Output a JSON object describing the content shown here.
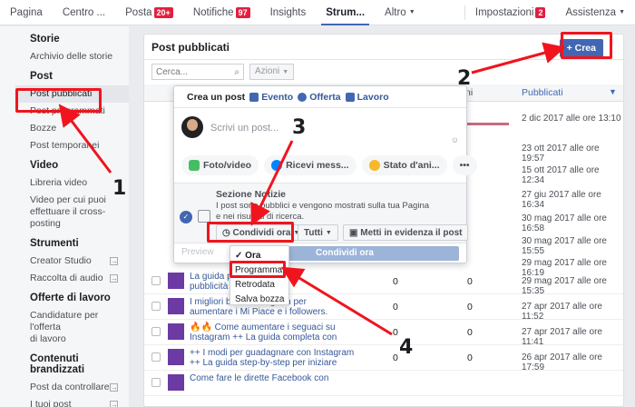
{
  "topnav": {
    "pagina": "Pagina",
    "centro": "Centro ...",
    "posta": "Posta",
    "posta_badge": "20+",
    "notifiche": "Notifiche",
    "notifiche_badge": "97",
    "insights": "Insights",
    "strumenti": "Strum...",
    "altro": "Altro",
    "impostazioni": "Impostazioni",
    "impostazioni_badge": "2",
    "assistenza": "Assistenza"
  },
  "sidebar": {
    "storie_h": "Storie",
    "archivio": "Archivio delle storie",
    "post_h": "Post",
    "pubblicati": "Post pubblicati",
    "programmati": "Post programmati",
    "bozze": "Bozze",
    "temporanei": "Post temporanei",
    "video_h": "Video",
    "libreria": "Libreria video",
    "cross1": "Video per cui puoi",
    "cross2": "effettuare il cross-",
    "cross3": "posting",
    "strumenti_h": "Strumenti",
    "creator": "Creator Studio",
    "raccolta": "Raccolta di audio",
    "offerte_h": "Offerte di lavoro",
    "candidature1": "Candidature per l'offerta",
    "candidature2": "di lavoro",
    "brand_h": "Contenuti brandizzati",
    "dacontrollare": "Post da controllare",
    "tuoipost": "I tuoi post"
  },
  "main": {
    "title": "Post pubblicati",
    "crea": "+ Crea",
    "search_placeholder": "Cerca...",
    "azioni": "Azioni",
    "col_m": "ni",
    "col_pubblicati": "Pubblicati",
    "dates_top": [
      "2 dic 2017 alle ore 13:10",
      "23 ott 2017 alle ore 19:57",
      "15 ott 2017 alle ore 12:34",
      "27 giu 2017 alle ore 16:34",
      "30 mag 2017 alle ore 16:58",
      "30 mag 2017 alle ore 15:55",
      "29 mag 2017 alle ore 16:19"
    ],
    "rows": [
      {
        "title": "La guida pe...\npubblicità s...",
        "n1": "0",
        "n2": "0",
        "date": "29 mag 2017 alle ore 15:35"
      },
      {
        "title": "I migliori bot di Instagram per\naumentare i Mi Piace e i followers.",
        "n1": "0",
        "n2": "0",
        "date": "27 apr 2017 alle ore 11:52"
      },
      {
        "title": "🔥🔥 Come aumentare i seguaci su\nInstagram ++ La guida completa con",
        "n1": "0",
        "n2": "0",
        "date": "27 apr 2017 alle ore 11:41"
      },
      {
        "title": "++ I modi per guadagnare con Instagram\n++ La guida step-by-step per iniziare",
        "n1": "0",
        "n2": "0",
        "date": "26 apr 2017 alle ore 17:59"
      },
      {
        "title": "Come fare le dirette Facebook con",
        "n1": "",
        "n2": "",
        "date": ""
      }
    ]
  },
  "composer": {
    "crea_post": "Crea un post",
    "evento": "Evento",
    "offerta": "Offerta",
    "lavoro": "Lavoro",
    "placeholder": "Scrivi un post...",
    "foto": "Foto/video",
    "ricevi": "Ricevi mess...",
    "stato": "Stato d'ani...",
    "more": "•••",
    "sezione": "Sezione Notizie",
    "desc": "I post sono pubblici e vengono mostrati sulla tua Pagina e nei risultati di ricerca.",
    "condividi_ora_btn": "Condividi ora",
    "tutti": "Tutti",
    "metti": "Metti in evidenza il post",
    "preview": "Preview",
    "condividi_ora": "Condividi ora"
  },
  "dropdown": {
    "ora": "Ora",
    "programma": "Programma",
    "retrodata": "Retrodata",
    "salva": "Salva bozza"
  },
  "annotations": {
    "n1": "1",
    "n2": "2",
    "n3": "3",
    "n4": "4"
  },
  "colors": {
    "accent": "#4267b2",
    "annotation_red": "#f0141e"
  }
}
